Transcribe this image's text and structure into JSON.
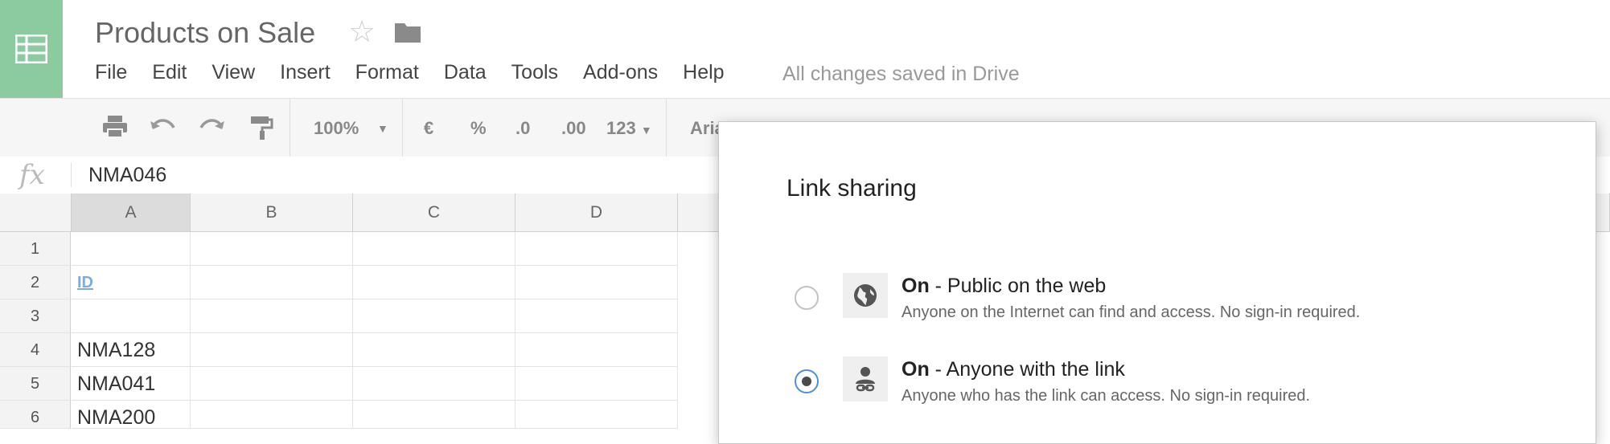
{
  "app": {
    "doc_title": "Products on Sale",
    "save_status": "All changes saved in Drive",
    "accent": "#8ccaa0"
  },
  "menu": [
    "File",
    "Edit",
    "View",
    "Insert",
    "Format",
    "Data",
    "Tools",
    "Add-ons",
    "Help"
  ],
  "toolbar": {
    "zoom": "100%",
    "currency": "€",
    "percent": "%",
    "dec_decrease": ".0",
    "dec_increase": ".00",
    "more_formats": "123",
    "font": "Aria"
  },
  "formula_bar": {
    "fx_label": "fx",
    "value": "NMA046"
  },
  "grid": {
    "columns": [
      "A",
      "B",
      "C",
      "D"
    ],
    "rows": [
      {
        "num": "1",
        "a": ""
      },
      {
        "num": "2",
        "a": "ID"
      },
      {
        "num": "3",
        "a": ""
      },
      {
        "num": "4",
        "a": "NMA128"
      },
      {
        "num": "5",
        "a": "NMA041"
      },
      {
        "num": "6",
        "a": "NMA200"
      }
    ]
  },
  "dialog": {
    "title": "Link sharing",
    "options": [
      {
        "state": "On",
        "label": " - Public on the web",
        "desc": "Anyone on the Internet can find and access. No sign-in required.",
        "selected": false,
        "icon": "globe-icon"
      },
      {
        "state": "On",
        "label": " - Anyone with the link",
        "desc": "Anyone who has the link can access. No sign-in required.",
        "selected": true,
        "icon": "person-link-icon"
      }
    ]
  }
}
